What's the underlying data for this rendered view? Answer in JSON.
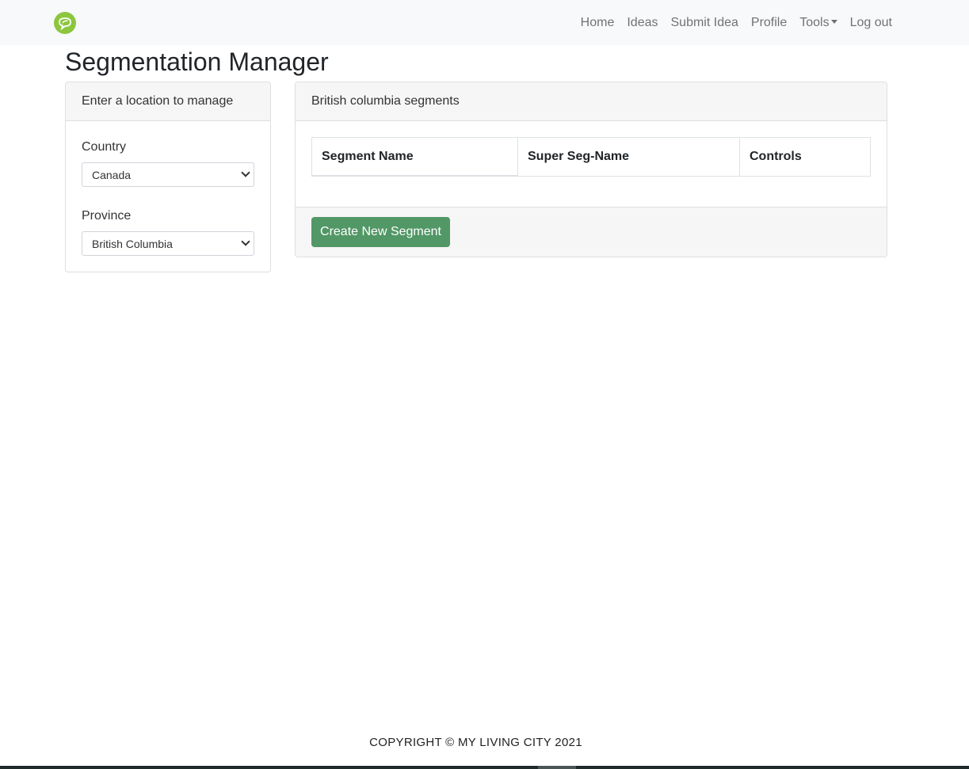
{
  "nav": {
    "logo_icon": "leaf-speech-bubble-icon",
    "brand_color": "#8cc63f",
    "links": [
      "Home",
      "Ideas",
      "Submit Idea",
      "Profile",
      "Tools",
      "Log out"
    ]
  },
  "page": {
    "title": "Segmentation Manager"
  },
  "location_card": {
    "header": "Enter a location to manage",
    "country_label": "Country",
    "country_value": "Canada",
    "province_label": "Province",
    "province_value": "British Columbia"
  },
  "segments_card": {
    "header": "British columbia segments",
    "columns": [
      "Segment Name",
      "Super Seg-Name",
      "Controls"
    ],
    "rows": [],
    "create_button": "Create New Segment",
    "button_color": "#529766"
  },
  "footer": {
    "copyright": "COPYRIGHT © MY LIVING CITY 2021"
  }
}
